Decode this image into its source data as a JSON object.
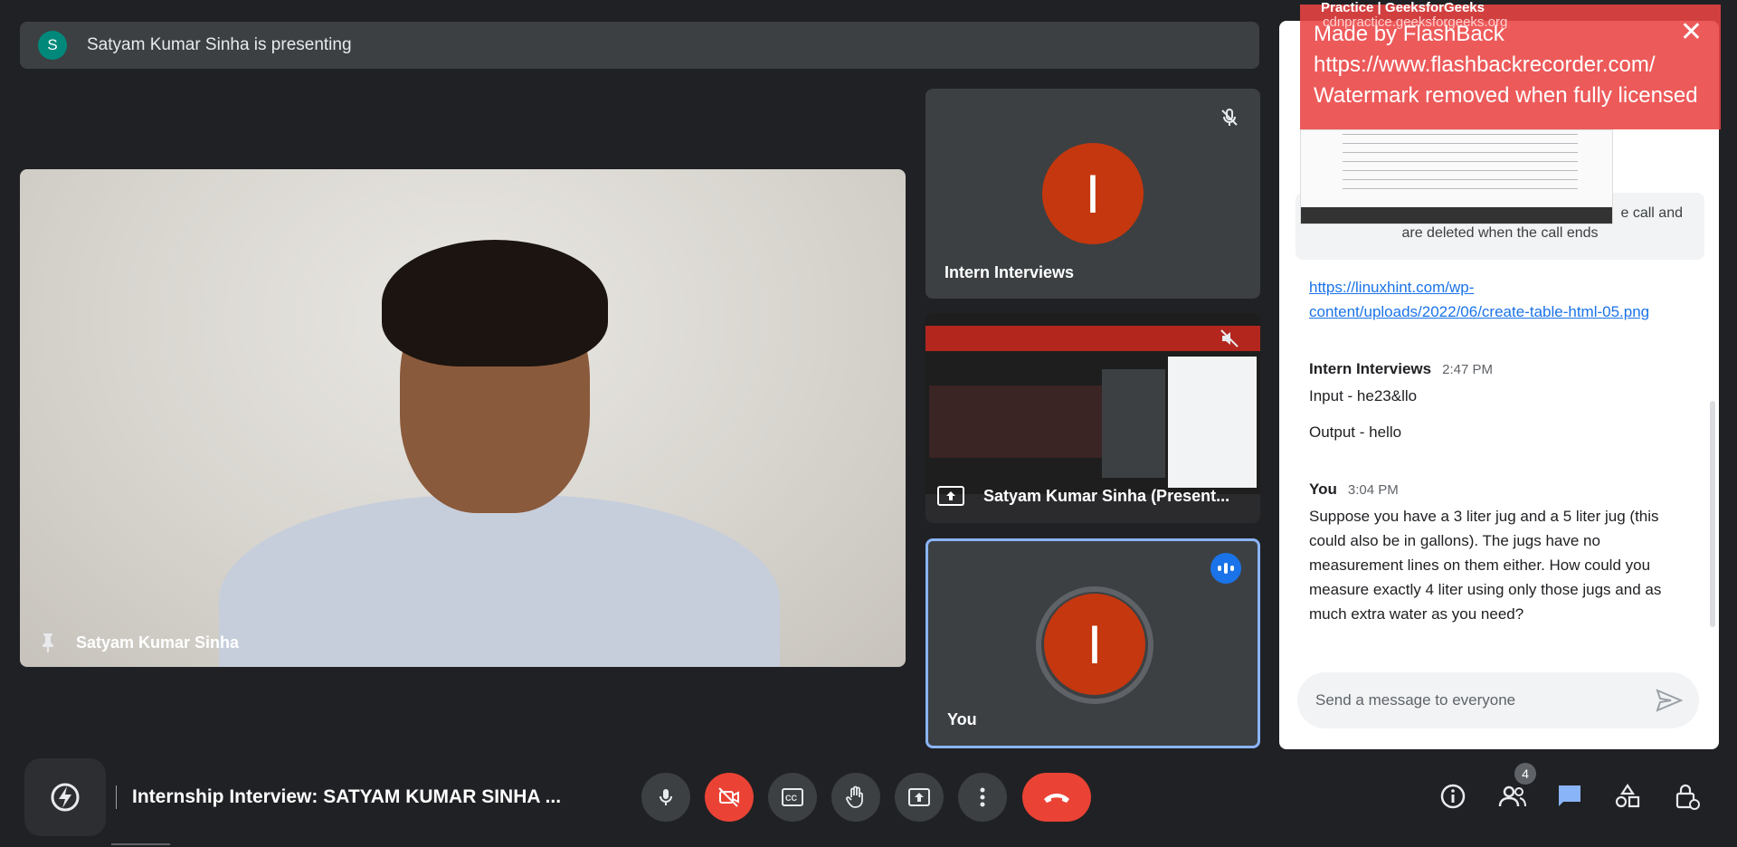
{
  "banner": {
    "avatar_letter": "S",
    "text": "Satyam Kumar Sinha is presenting"
  },
  "main_video": {
    "name": "Satyam Kumar Sinha"
  },
  "tiles": [
    {
      "name": "Intern Interviews",
      "avatar_letter": "I"
    },
    {
      "name": "Satyam Kumar Sinha (Present..."
    },
    {
      "name": "You",
      "avatar_letter": "I"
    }
  ],
  "watermark": {
    "bg_title": "Practice | GeeksforGeeks",
    "bg_url": "cdnpractice.geeksforgeeks.org",
    "line1": "Made by FlashBack",
    "line2": "https://www.flashbackrecorder.com/",
    "line3": "Watermark removed when fully licensed",
    "close_label": "✕"
  },
  "chat": {
    "notice_partial": "e call and",
    "notice_line2": "are deleted when the call ends",
    "link": "https://linuxhint.com/wp-content/uploads/2022/06/create-table-html-05.png",
    "messages": [
      {
        "sender": "Intern Interviews",
        "time": "2:47 PM",
        "lines": [
          "Input - he23&llo",
          "Output - hello"
        ]
      },
      {
        "sender": "You",
        "time": "3:04 PM",
        "lines": [
          "Suppose you have a 3 liter jug and a 5 liter jug (this could also be in gallons). The jugs have no measurement lines on them either. How could you measure exactly 4 liter using only those jugs and as much extra water as you need?"
        ]
      }
    ],
    "input_placeholder": "Send a message to everyone"
  },
  "bottom_bar": {
    "meeting_title": "Internship Interview: SATYAM KUMAR SINHA ...",
    "participant_count": "4",
    "controls": [
      "mic-icon",
      "camera-off-icon",
      "captions-icon",
      "raise-hand-icon",
      "present-icon",
      "more-icon",
      "end-call-icon"
    ],
    "right_controls": [
      "info-icon",
      "people-icon",
      "chat-icon",
      "activities-icon",
      "host-controls-icon"
    ]
  },
  "colors": {
    "accent": "#8ab4f8",
    "danger": "#ea4335",
    "avatar": "#c5370e",
    "bg": "#202124"
  }
}
